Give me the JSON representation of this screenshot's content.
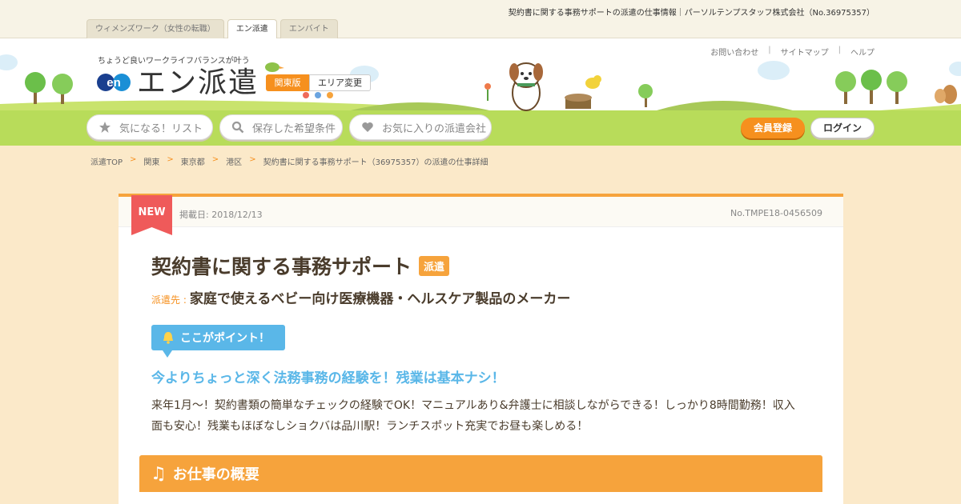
{
  "top_info": "契約書に関する事務サポートの派遣の仕事情報｜パーソルテンプスタッフ株式会社（No.36975357）",
  "tabs": [
    {
      "label": "ウィメンズワーク（女性の転職）"
    },
    {
      "label": "エン派遣"
    },
    {
      "label": "エンバイト"
    }
  ],
  "header": {
    "tagline": "ちょうど良いワークライフバランスが叶う",
    "logo_mark": "en",
    "logo_text": "エン派遣",
    "region": "関東版",
    "area_change": "エリア変更",
    "util_links": [
      "お問い合わせ",
      "サイトマップ",
      "ヘルプ"
    ],
    "util_sep": "|",
    "nav": [
      "気になる！リスト",
      "保存した希望条件",
      "お気に入りの派遣会社"
    ],
    "register": "会員登録",
    "login": "ログイン"
  },
  "breadcrumb": {
    "items": [
      "派遣TOP",
      "関東",
      "東京都",
      "港区",
      "契約書に関する事務サポート（36975357）の派遣の仕事詳細"
    ],
    "sep": ">"
  },
  "job": {
    "new_label": "NEW",
    "posted": "掲載日: 2018/12/13",
    "job_no": "No.TMPE18-0456509",
    "title": "契約書に関する事務サポート",
    "type_badge": "派遣",
    "dest_label": "派遣先 :",
    "dest_value": "家庭で使えるベビー向け医療機器・ヘルスケア製品のメーカー",
    "point_label": "ここがポイント！",
    "catch": "今よりちょっと深く法務事務の経験を！残業は基本ナシ！",
    "description": "来年1月～！契約書類の簡単なチェックの経験でOK！マニュアルあり&弁護士に相談しながらできる！しっかり8時間勤務！収入面も安心！残業もほぼなしショクバは品川駅！ランチスポット充実でお昼も楽しめる！",
    "section_title": "お仕事の概要"
  },
  "colors": {
    "accent": "#f6901e",
    "accent_light": "#f6a33c",
    "sky": "#5ab7e8",
    "grass": "#b8dc5a",
    "ribbon": "#ef5a5a"
  },
  "icons": [
    "star-icon",
    "search-icon",
    "heart-icon",
    "bell-icon",
    "music-note-icon"
  ]
}
